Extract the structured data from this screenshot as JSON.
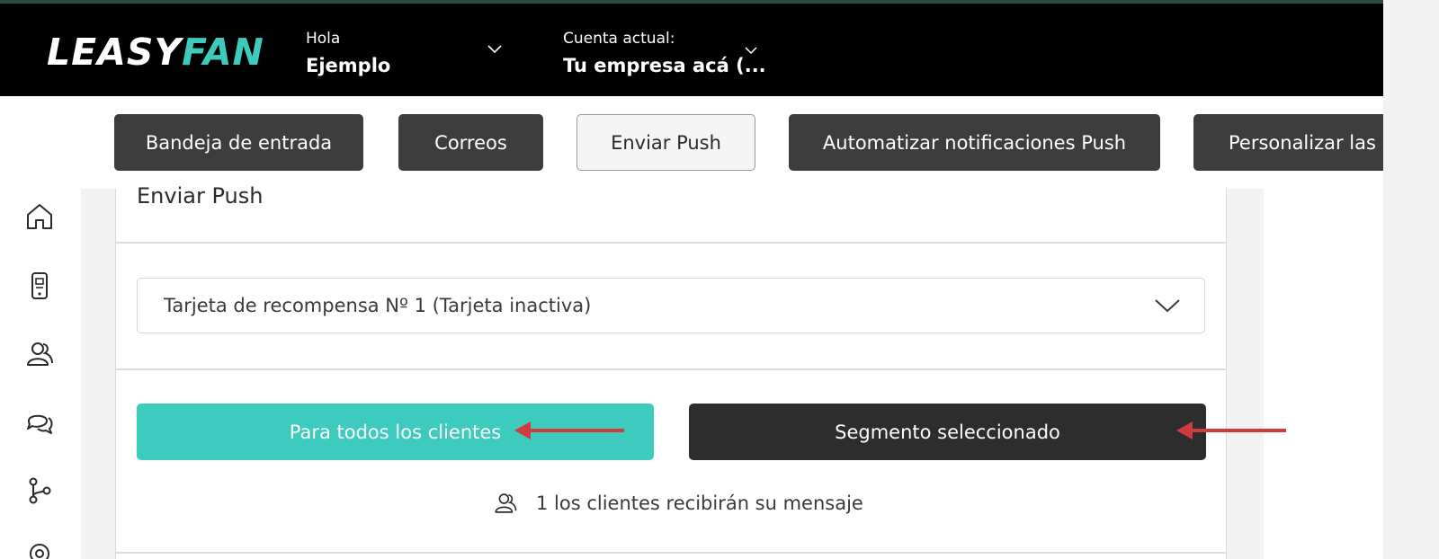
{
  "header": {
    "logo_part1": "LEASY",
    "logo_part2": "FAN",
    "greeting_label": "Hola",
    "user_name": "Ejemplo",
    "account_label": "Cuenta actual:",
    "account_name": "Tu empresa acá (..."
  },
  "tabs": [
    {
      "label": "Bandeja de entrada",
      "active": false
    },
    {
      "label": "Correos",
      "active": false
    },
    {
      "label": "Enviar Push",
      "active": true
    },
    {
      "label": "Automatizar notificaciones Push",
      "active": false
    },
    {
      "label": "Personalizar las n",
      "active": false
    }
  ],
  "sidebar": {
    "icons": [
      "home-icon",
      "mobile-card-icon",
      "users-icon",
      "chat-icon",
      "flow-icon",
      "location-icon"
    ]
  },
  "main": {
    "title": "Enviar Push",
    "card_select": "Tarjeta de recompensa Nº 1 (Tarjeta inactiva)",
    "button_all": "Para todos los clientes",
    "button_segment": "Segmento seleccionado",
    "recipients_text": "1 los clientes recibirán su mensaje"
  },
  "colors": {
    "accent": "#3ccbbd",
    "header_bg": "#000000",
    "tab_dark": "#3d3d3d",
    "arrow_red": "#d03a40"
  }
}
